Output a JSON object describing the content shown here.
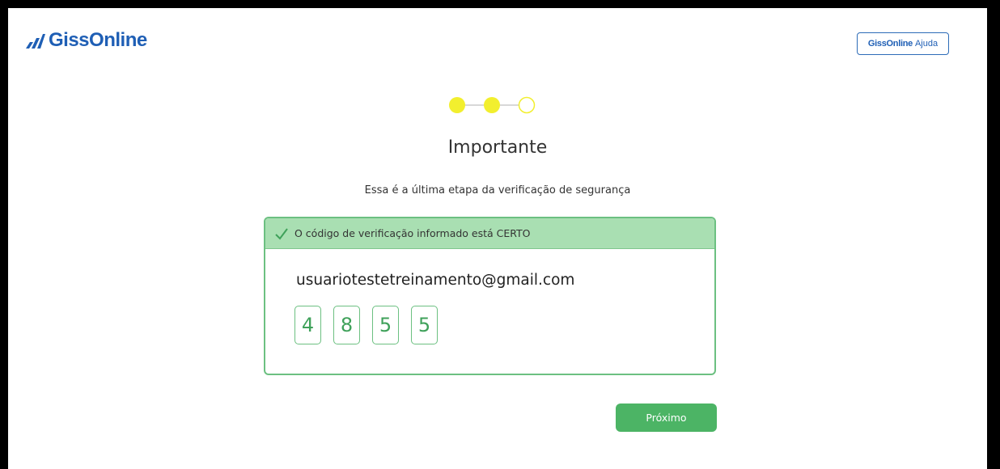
{
  "header": {
    "logo_text": "GissOnline",
    "help_button": {
      "brand": "GissOnline",
      "label": "Ajuda"
    }
  },
  "stepper": {
    "total_steps": 3,
    "completed_steps": 2,
    "active_color": "#f2ef2e"
  },
  "main": {
    "title": "Importante",
    "subtitle": "Essa é a última etapa da verificação de segurança"
  },
  "verification_card": {
    "status_message": "O código de verificação informado está CERTO",
    "email": "usuariotestetreinamento@gmail.com",
    "code_digits": [
      "4",
      "8",
      "5",
      "5"
    ]
  },
  "actions": {
    "next_label": "Próximo"
  },
  "colors": {
    "brand_blue": "#1f5fb5",
    "success_green": "#4cb465",
    "banner_green": "#a9dfb2",
    "code_green": "#3fa15a"
  }
}
